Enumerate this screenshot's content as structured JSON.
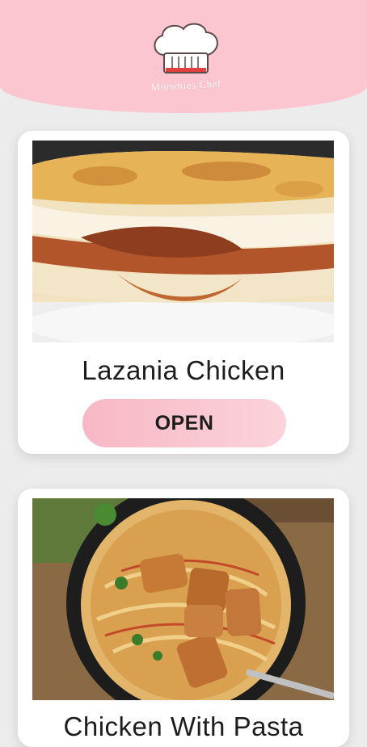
{
  "app": {
    "logo_text": "Mommies Chef"
  },
  "recipes": [
    {
      "title": "Lazania Chicken",
      "button_label": "OPEN",
      "image": "lasagna-photo"
    },
    {
      "title": "Chicken With Pasta",
      "image": "chicken-pasta-photo"
    }
  ],
  "colors": {
    "header": "#fcc6d0",
    "button": "#f7b8c4",
    "background": "#ececec"
  }
}
